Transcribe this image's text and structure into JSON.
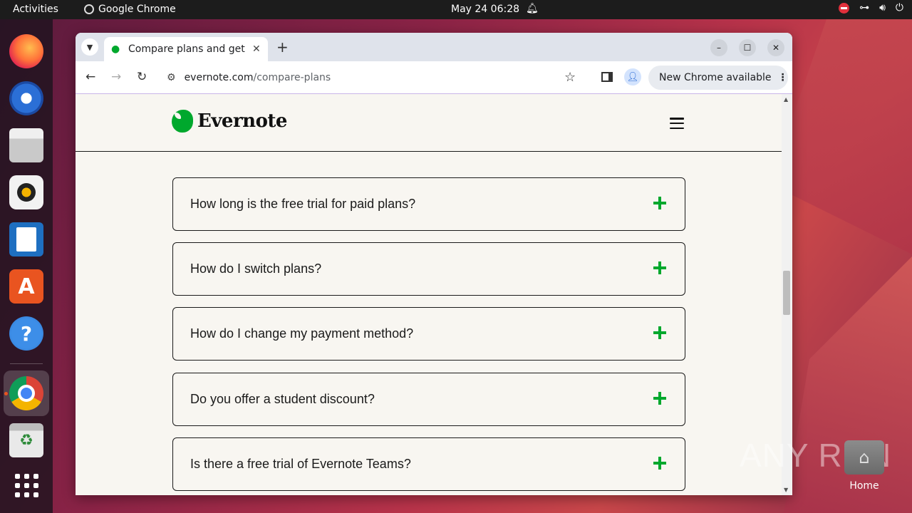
{
  "topbar": {
    "activities": "Activities",
    "app_name": "Google Chrome",
    "clock": "May 24  06:28"
  },
  "dock": {
    "items": [
      "Firefox",
      "Thunderbird",
      "Files",
      "Rhythmbox",
      "LibreOffice Writer",
      "Ubuntu Software",
      "Help",
      "Google Chrome",
      "Trash",
      "Show Applications"
    ]
  },
  "browser": {
    "tab_title": "Compare plans and get s",
    "url_domain": "evernote.com",
    "url_path": "/compare-plans",
    "update_label": "New Chrome available"
  },
  "page": {
    "logo_text": "Evernote",
    "faqs": [
      "How long is the free trial for paid plans?",
      "How do I switch plans?",
      "How do I change my payment method?",
      "Do you offer a student discount?",
      "Is there a free trial of Evernote Teams?"
    ]
  },
  "desktop": {
    "home_label": "Home",
    "watermark": "ANY RUN"
  },
  "colors": {
    "evernote_green": "#00a82d",
    "page_bg": "#f8f6f1",
    "ubuntu_orange": "#e95420"
  }
}
